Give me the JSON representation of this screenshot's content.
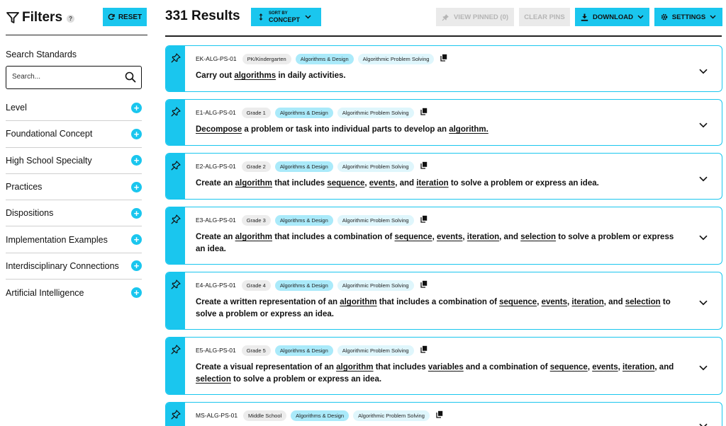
{
  "sidebar": {
    "title": "Filters",
    "help": "?",
    "reset_label": "RESET",
    "search_label": "Search Standards",
    "search_placeholder": "Search...",
    "filters": [
      {
        "label": "Level"
      },
      {
        "label": "Foundational Concept"
      },
      {
        "label": "High School Specialty"
      },
      {
        "label": "Practices"
      },
      {
        "label": "Dispositions"
      },
      {
        "label": "Implementation Examples"
      },
      {
        "label": "Interdisciplinary Connections"
      },
      {
        "label": "Artificial Intelligence"
      }
    ]
  },
  "toolbar": {
    "results": "331 Results",
    "sort_small": "SORT BY",
    "sort_value": "CONCEPT",
    "view_pinned": "VIEW PINNED (0)",
    "clear_pins": "CLEAR PINS",
    "download": "DOWNLOAD",
    "settings": "SETTINGS"
  },
  "colors": {
    "accent": "#1ac6ee",
    "chip_blue": "#aaeafa",
    "chip_grey": "#ececec"
  },
  "cards": [
    {
      "code": "EK-ALG-PS-01",
      "grade": "PK/Kindergarten",
      "concept": "Algorithms & Design",
      "subconcept": "Algorithmic Problem Solving",
      "parts": [
        [
          "t",
          "Carry out "
        ],
        [
          "u",
          "algorithms"
        ],
        [
          "t",
          " in daily activities."
        ]
      ]
    },
    {
      "code": "E1-ALG-PS-01",
      "grade": "Grade 1",
      "concept": "Algorithms & Design",
      "subconcept": "Algorithmic Problem Solving",
      "parts": [
        [
          "u",
          "Decompose"
        ],
        [
          "t",
          " a problem or task into individual parts to develop an "
        ],
        [
          "u",
          "algorithm."
        ]
      ]
    },
    {
      "code": "E2-ALG-PS-01",
      "grade": "Grade 2",
      "concept": "Algorithms & Design",
      "subconcept": "Algorithmic Problem Solving",
      "parts": [
        [
          "t",
          "Create an "
        ],
        [
          "u",
          "algorithm"
        ],
        [
          "t",
          " that includes "
        ],
        [
          "u",
          "sequence"
        ],
        [
          "t",
          ", "
        ],
        [
          "u",
          "events"
        ],
        [
          "t",
          ", and "
        ],
        [
          "u",
          "iteration"
        ],
        [
          "t",
          " to solve a problem or express an idea."
        ]
      ]
    },
    {
      "code": "E3-ALG-PS-01",
      "grade": "Grade 3",
      "concept": "Algorithms & Design",
      "subconcept": "Algorithmic Problem Solving",
      "parts": [
        [
          "t",
          "Create an "
        ],
        [
          "u",
          "algorithm"
        ],
        [
          "t",
          " that includes a combination of "
        ],
        [
          "u",
          "sequence"
        ],
        [
          "t",
          ", "
        ],
        [
          "u",
          "events"
        ],
        [
          "t",
          ", "
        ],
        [
          "u",
          "iteration"
        ],
        [
          "t",
          ", and "
        ],
        [
          "u",
          "selection"
        ],
        [
          "t",
          " to solve a problem or express an idea."
        ]
      ]
    },
    {
      "code": "E4-ALG-PS-01",
      "grade": "Grade 4",
      "concept": "Algorithms & Design",
      "subconcept": "Algorithmic Problem Solving",
      "parts": [
        [
          "t",
          "Create a written representation of an "
        ],
        [
          "u",
          "algorithm"
        ],
        [
          "t",
          " that includes a combination of "
        ],
        [
          "u",
          "sequence"
        ],
        [
          "t",
          ", "
        ],
        [
          "u",
          "events"
        ],
        [
          "t",
          ", "
        ],
        [
          "u",
          "iteration"
        ],
        [
          "t",
          ", and "
        ],
        [
          "u",
          "selection"
        ],
        [
          "t",
          " to solve a problem or express an idea."
        ]
      ]
    },
    {
      "code": "E5-ALG-PS-01",
      "grade": "Grade 5",
      "concept": "Algorithms & Design",
      "subconcept": "Algorithmic Problem Solving",
      "parts": [
        [
          "t",
          "Create a visual representation of an "
        ],
        [
          "u",
          "algorithm"
        ],
        [
          "t",
          " that includes "
        ],
        [
          "u",
          "variables"
        ],
        [
          "t",
          " and a combination of "
        ],
        [
          "u",
          "sequence"
        ],
        [
          "t",
          ", "
        ],
        [
          "u",
          "events"
        ],
        [
          "t",
          ", "
        ],
        [
          "u",
          "iteration"
        ],
        [
          "t",
          ", and "
        ],
        [
          "u",
          "selection"
        ],
        [
          "t",
          " to solve a problem or express an idea."
        ]
      ]
    },
    {
      "code": "MS-ALG-PS-01",
      "grade": "Middle School",
      "concept": "Algorithms & Design",
      "subconcept": "Algorithmic Problem Solving",
      "parts": []
    }
  ]
}
